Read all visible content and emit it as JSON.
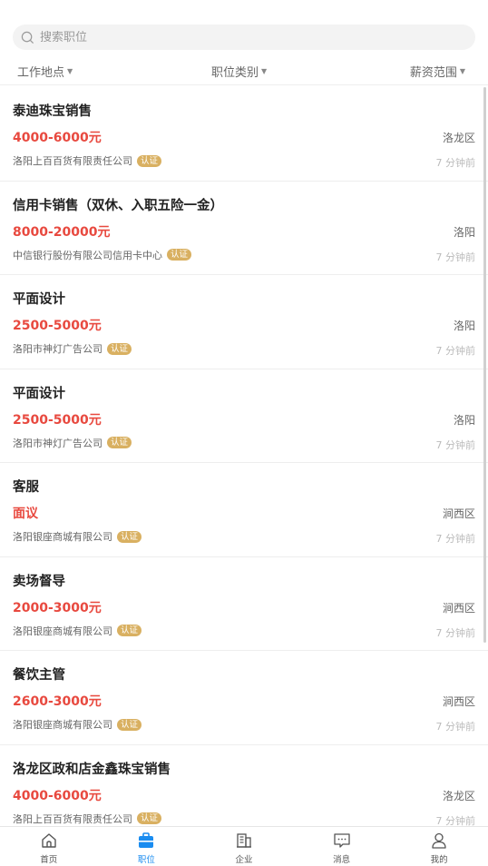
{
  "search": {
    "placeholder": "搜索职位"
  },
  "filters": [
    {
      "label": "工作地点"
    },
    {
      "label": "职位类别"
    },
    {
      "label": "薪资范围"
    }
  ],
  "jobs": [
    {
      "title": "泰迪珠宝销售",
      "salary": "4000-6000元",
      "location": "洛龙区",
      "company": "洛阳上百百货有限责任公司",
      "badge": "认证",
      "time": "7 分钟前"
    },
    {
      "title": "信用卡销售（双休、入职五险一金）",
      "salary": "8000-20000元",
      "location": "洛阳",
      "company": "中信银行股份有限公司信用卡中心",
      "badge": "认证",
      "time": "7 分钟前"
    },
    {
      "title": "平面设计",
      "salary": "2500-5000元",
      "location": "洛阳",
      "company": "洛阳市神灯广告公司",
      "badge": "认证",
      "time": "7 分钟前"
    },
    {
      "title": "平面设计",
      "salary": "2500-5000元",
      "location": "洛阳",
      "company": "洛阳市神灯广告公司",
      "badge": "认证",
      "time": "7 分钟前"
    },
    {
      "title": "客服",
      "salary": "面议",
      "location": "涧西区",
      "company": "洛阳银座商城有限公司",
      "badge": "认证",
      "time": "7 分钟前"
    },
    {
      "title": "卖场督导",
      "salary": "2000-3000元",
      "location": "涧西区",
      "company": "洛阳银座商城有限公司",
      "badge": "认证",
      "time": "7 分钟前"
    },
    {
      "title": "餐饮主管",
      "salary": "2600-3000元",
      "location": "涧西区",
      "company": "洛阳银座商城有限公司",
      "badge": "认证",
      "time": "7 分钟前"
    },
    {
      "title": "洛龙区政和店金鑫珠宝销售",
      "salary": "4000-6000元",
      "location": "洛龙区",
      "company": "洛阳上百百货有限责任公司",
      "badge": "认证",
      "time": "7 分钟前"
    }
  ],
  "tabs": [
    {
      "label": "首页",
      "icon": "home-icon"
    },
    {
      "label": "职位",
      "icon": "briefcase-icon"
    },
    {
      "label": "企业",
      "icon": "building-icon"
    },
    {
      "label": "消息",
      "icon": "message-icon"
    },
    {
      "label": "我的",
      "icon": "user-icon"
    }
  ],
  "colors": {
    "accent": "#1a8cf0",
    "salary": "#e8493f",
    "badge": "#d9b061"
  }
}
